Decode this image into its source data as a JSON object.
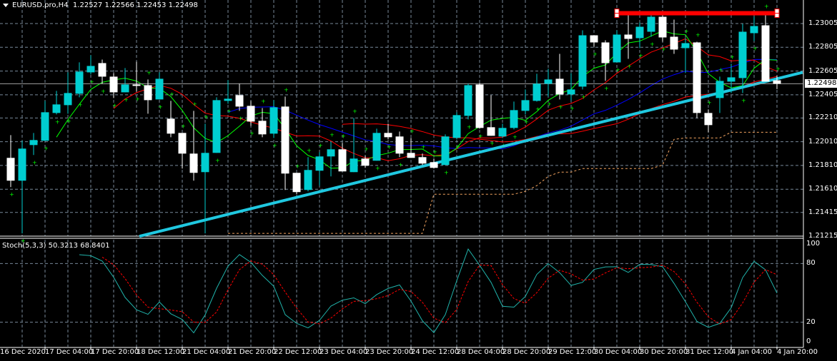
{
  "header": {
    "symbol": "EURUSD.pro,H4",
    "open": "1.22527",
    "high": "1.22566",
    "low": "1.22453",
    "close": "1.22498"
  },
  "current_price": "1.22498",
  "price_axis": [
    "1.23005",
    "1.22805",
    "1.22605",
    "1.22405",
    "1.22210",
    "1.22010",
    "1.21810",
    "1.21610",
    "1.21415",
    "1.21215"
  ],
  "stoch": {
    "label": "Stoch(5,3,3)",
    "main": "50.3213",
    "signal": "68.8401",
    "levels": [
      "100",
      "80",
      "20",
      "0"
    ]
  },
  "time_axis": [
    "16 Dec 2020",
    "17 Dec 04:00",
    "17 Dec 20:00",
    "18 Dec 12:00",
    "21 Dec 04:00",
    "21 Dec 20:00",
    "22 Dec 12:00",
    "23 Dec 04:00",
    "23 Dec 20:00",
    "24 Dec 12:00",
    "28 Dec 04:00",
    "28 Dec 20:00",
    "29 Dec 12:00",
    "30 Dec 04:00",
    "30 Dec 20:00",
    "31 Dec 12:00",
    "4 Jan 04:00",
    "4 Jan 20:00"
  ],
  "colors": {
    "bull": "#00CED1",
    "bear": "#FFFFFF",
    "grid": "#778899",
    "trendline": "#20C8E0",
    "zone": "#FF0000"
  },
  "chart_data": {
    "type": "candlestick",
    "ylim": [
      1.21215,
      1.231
    ],
    "candles_ohlc": [
      [
        1.21874,
        1.22066,
        1.21628,
        1.21682
      ],
      [
        1.21682,
        1.22018,
        1.21238,
        1.21952
      ],
      [
        1.21982,
        1.22084,
        1.21898,
        1.22024
      ],
      [
        1.22018,
        1.22354,
        1.22018,
        1.22258
      ],
      [
        1.22252,
        1.22438,
        1.2224,
        1.22324
      ],
      [
        1.22318,
        1.22594,
        1.22246,
        1.2242
      ],
      [
        1.22414,
        1.22678,
        1.22384,
        1.226
      ],
      [
        1.22594,
        1.22738,
        1.22576,
        1.22648
      ],
      [
        1.22672,
        1.22702,
        1.22498,
        1.22558
      ],
      [
        1.22558,
        1.22588,
        1.22378,
        1.22426
      ],
      [
        1.22426,
        1.2263,
        1.22426,
        1.22492
      ],
      [
        1.22492,
        1.22684,
        1.22432,
        1.2248
      ],
      [
        1.22486,
        1.22534,
        1.22246,
        1.2236
      ],
      [
        1.22366,
        1.22594,
        1.22366,
        1.2254
      ],
      [
        1.22204,
        1.22354,
        1.22048,
        1.22078
      ],
      [
        1.22084,
        1.22084,
        1.21784,
        1.2191
      ],
      [
        1.2191,
        1.2227,
        1.21682,
        1.21748
      ],
      [
        1.21754,
        1.22162,
        1.21238,
        1.21916
      ],
      [
        1.21916,
        1.22384,
        1.21916,
        1.2236
      ],
      [
        1.22354,
        1.22528,
        1.2233,
        1.22372
      ],
      [
        1.22402,
        1.22498,
        1.2227,
        1.22306
      ],
      [
        1.22312,
        1.22354,
        1.22144,
        1.2218
      ],
      [
        1.22186,
        1.22294,
        1.22048,
        1.22072
      ],
      [
        1.22078,
        1.2236,
        1.22042,
        1.223
      ],
      [
        1.22306,
        1.2239,
        1.21604,
        1.21742
      ],
      [
        1.21748,
        1.21748,
        1.21568,
        1.21586
      ],
      [
        1.21604,
        1.2188,
        1.21592,
        1.21772
      ],
      [
        1.21766,
        1.21922,
        1.2164,
        1.21886
      ],
      [
        1.21886,
        1.22012,
        1.21718,
        1.21946
      ],
      [
        1.21946,
        1.22,
        1.2176,
        1.2176
      ],
      [
        1.21754,
        1.2221,
        1.21754,
        1.21868
      ],
      [
        1.21868,
        1.21892,
        1.2179,
        1.21808
      ],
      [
        1.2185,
        1.2212,
        1.2185,
        1.22084
      ],
      [
        1.22084,
        1.22162,
        1.2203,
        1.22048
      ],
      [
        1.22054,
        1.22096,
        1.2188,
        1.2191
      ],
      [
        1.21916,
        1.22042,
        1.21874,
        1.21874
      ],
      [
        1.2188,
        1.2191,
        1.21814,
        1.21826
      ],
      [
        1.21838,
        1.21868,
        1.21784,
        1.2179
      ],
      [
        1.21814,
        1.22072,
        1.21814,
        1.22054
      ],
      [
        1.22042,
        1.22258,
        1.2203,
        1.22234
      ],
      [
        1.22228,
        1.22498,
        1.22198,
        1.22486
      ],
      [
        1.22492,
        1.22504,
        1.2212,
        1.22126
      ],
      [
        1.22132,
        1.22402,
        1.2206,
        1.2206
      ],
      [
        1.22054,
        1.22162,
        1.22042,
        1.22126
      ],
      [
        1.22126,
        1.22348,
        1.22114,
        1.22276
      ],
      [
        1.2227,
        1.2245,
        1.2224,
        1.2236
      ],
      [
        1.22354,
        1.22582,
        1.22348,
        1.22498
      ],
      [
        1.22498,
        1.22624,
        1.2239,
        1.22534
      ],
      [
        1.2254,
        1.2275,
        1.22366,
        1.22408
      ],
      [
        1.22408,
        1.22588,
        1.22354,
        1.2245
      ],
      [
        1.22474,
        1.22948,
        1.2245,
        1.22906
      ],
      [
        1.22906,
        1.22906,
        1.2281,
        1.22846
      ],
      [
        1.22846,
        1.22864,
        1.22522,
        1.22672
      ],
      [
        1.22678,
        1.22948,
        1.22678,
        1.22912
      ],
      [
        1.22912,
        1.23098,
        1.22708,
        1.22876
      ],
      [
        1.22882,
        1.23014,
        1.22798,
        1.22978
      ],
      [
        1.22936,
        1.23092,
        1.22894,
        1.23062
      ],
      [
        1.23062,
        1.23098,
        1.22852,
        1.22888
      ],
      [
        1.22894,
        1.23038,
        1.2275,
        1.22786
      ],
      [
        1.22798,
        1.22882,
        1.22588,
        1.2284
      ],
      [
        1.22846,
        1.22852,
        1.2221,
        1.22252
      ],
      [
        1.22252,
        1.22282,
        1.2209,
        1.2215
      ],
      [
        1.22378,
        1.22558,
        1.22252,
        1.22522
      ],
      [
        1.22516,
        1.22666,
        1.2242,
        1.22552
      ],
      [
        1.22546,
        1.23002,
        1.2242,
        1.22936
      ],
      [
        1.22924,
        1.23062,
        1.22858,
        1.22984
      ],
      [
        1.2299,
        1.23092,
        1.22516,
        1.22516
      ],
      [
        1.22527,
        1.22566,
        1.22453,
        1.22498
      ]
    ],
    "trendline": {
      "from": [
        11.25,
        1.21214
      ],
      "to": [
        69.25,
        1.22594
      ]
    },
    "resistance_zone": {
      "from_index": 53,
      "to_index": 67,
      "top": 1.2311,
      "bottom": 1.23074
    },
    "stoch_params": [
      5,
      3,
      3
    ]
  }
}
